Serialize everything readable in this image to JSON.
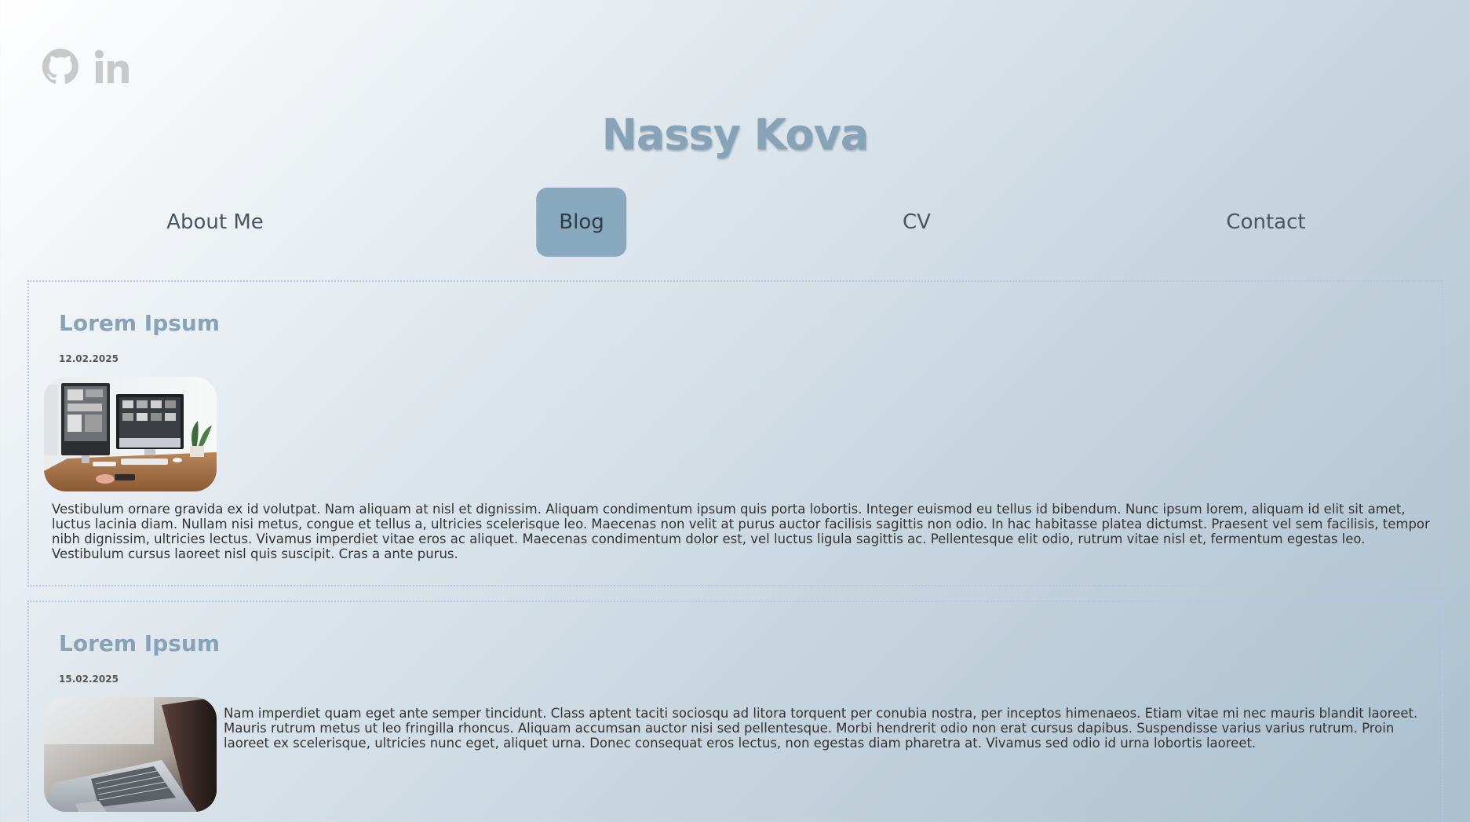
{
  "social": {
    "github_icon": "github-icon",
    "linkedin_icon": "linkedin-icon"
  },
  "site": {
    "title": "Nassy Kova"
  },
  "nav": {
    "items": [
      {
        "label": "About Me"
      },
      {
        "label": "Blog",
        "active": true
      },
      {
        "label": "CV"
      },
      {
        "label": "Contact"
      }
    ]
  },
  "colors": {
    "accent": "#86a3b8",
    "active_nav_bg": "#89a9be",
    "post_border": "#b8c6e4"
  },
  "posts": [
    {
      "title": "Lorem Ipsum",
      "date": "12.02.2025",
      "image": "desktop-monitors-photo",
      "text": "Vestibulum ornare gravida ex id volutpat. Nam aliquam at nisl et dignissim. Aliquam condimentum ipsum quis porta lobortis. Integer euismod eu tellus id bibendum. Nunc ipsum lorem, aliquam id elit sit amet, luctus lacinia diam. Nullam nisi metus, congue et tellus a, ultricies scelerisque leo. Maecenas non velit at purus auctor facilisis sagittis non odio. In hac habitasse platea dictumst. Praesent vel sem facilisis, tempor nibh dignissim, ultricies lectus. Vivamus imperdiet vitae eros ac aliquet. Maecenas condimentum dolor est, vel luctus ligula sagittis ac. Pellentesque elit odio, rutrum vitae nisl et, fermentum egestas leo. Vestibulum cursus laoreet nisl quis suscipit. Cras a ante purus."
    },
    {
      "title": "Lorem Ipsum",
      "date": "15.02.2025",
      "image": "laptop-photo",
      "text": "Nam imperdiet quam eget ante semper tincidunt. Class aptent taciti sociosqu ad litora torquent per conubia nostra, per inceptos himenaeos. Etiam vitae mi nec mauris blandit laoreet. Mauris rutrum metus ut leo fringilla rhoncus. Aliquam accumsan auctor nisi sed pellentesque. Morbi hendrerit odio non erat cursus dapibus. Suspendisse varius varius rutrum. Proin laoreet ex scelerisque, ultricies nunc eget, aliquet urna. Donec consequat eros lectus, non egestas diam pharetra at. Vivamus sed odio id urna lobortis laoreet."
    }
  ]
}
